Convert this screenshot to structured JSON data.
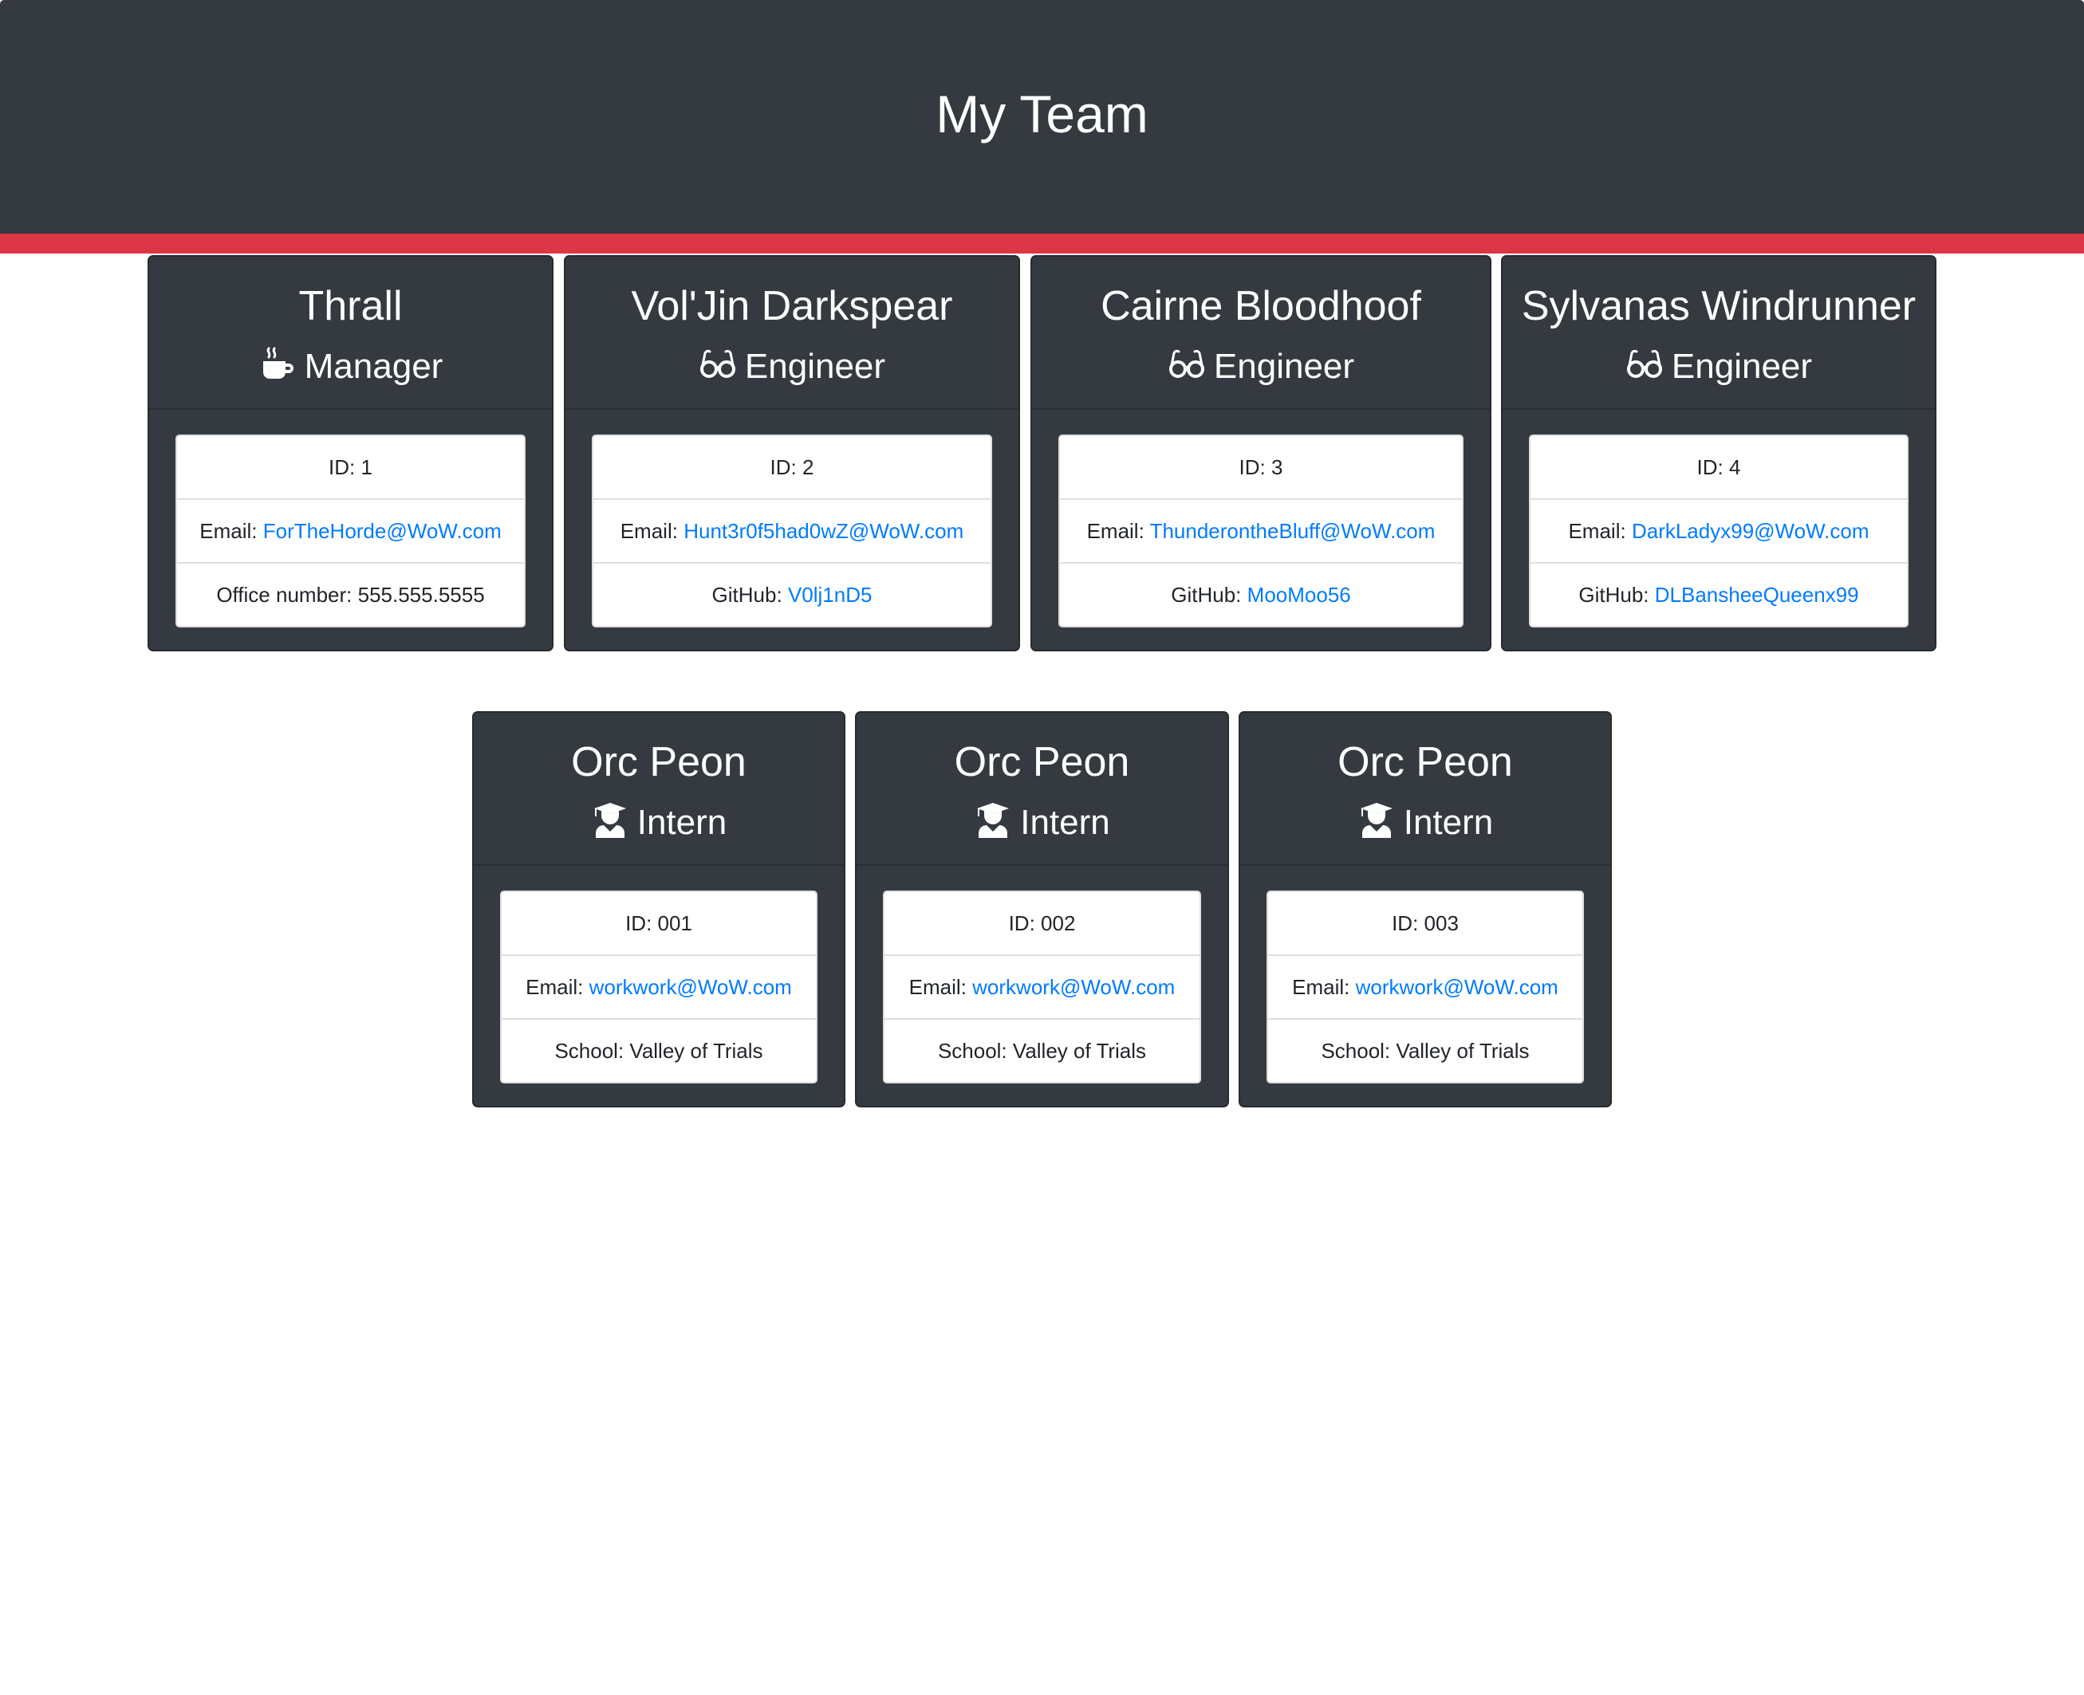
{
  "header": {
    "title": "My Team"
  },
  "colors": {
    "header_bg": "#343a40",
    "stripe": "#dc3545",
    "link": "#007bff",
    "text": "#212529"
  },
  "team": [
    {
      "name": "Thrall",
      "role": "Manager",
      "icon": "mug-icon",
      "id_label": "ID:",
      "id": "1",
      "email_label": "Email:",
      "email": "ForTheHorde@WoW.com",
      "extra_label": "Office number:",
      "extra": "555.555.5555"
    },
    {
      "name": "Vol'Jin Darkspear",
      "role": "Engineer",
      "icon": "glasses-icon",
      "id_label": "ID:",
      "id": "2",
      "email_label": "Email:",
      "email": "Hunt3r0f5had0wZ@WoW.com",
      "extra_label": "GitHub:",
      "extra": "V0lj1nD5"
    },
    {
      "name": "Cairne Bloodhoof",
      "role": "Engineer",
      "icon": "glasses-icon",
      "id_label": "ID:",
      "id": "3",
      "email_label": "Email:",
      "email": "ThunderontheBluff@WoW.com",
      "extra_label": "GitHub:",
      "extra": "MooMoo56"
    },
    {
      "name": "Sylvanas Windrunner",
      "role": "Engineer",
      "icon": "glasses-icon",
      "id_label": "ID:",
      "id": "4",
      "email_label": "Email:",
      "email": "DarkLadyx99@WoW.com",
      "extra_label": "GitHub:",
      "extra": "DLBansheeQueenx99"
    },
    {
      "name": "Orc Peon",
      "role": "Intern",
      "icon": "graduate-icon",
      "id_label": "ID:",
      "id": "001",
      "email_label": "Email:",
      "email": "workwork@WoW.com",
      "extra_label": "School:",
      "extra": "Valley of Trials"
    },
    {
      "name": "Orc Peon",
      "role": "Intern",
      "icon": "graduate-icon",
      "id_label": "ID:",
      "id": "002",
      "email_label": "Email:",
      "email": "workwork@WoW.com",
      "extra_label": "School:",
      "extra": "Valley of Trials"
    },
    {
      "name": "Orc Peon",
      "role": "Intern",
      "icon": "graduate-icon",
      "id_label": "ID:",
      "id": "003",
      "email_label": "Email:",
      "email": "workwork@WoW.com",
      "extra_label": "School:",
      "extra": "Valley of Trials"
    }
  ]
}
